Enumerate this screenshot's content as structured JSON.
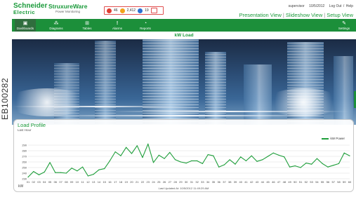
{
  "side_code": "EB100282",
  "header": {
    "brand_name": "Schneider",
    "brand_sub": "Electric",
    "product_name": "StruxureWare",
    "product_sub": "Power Monitoring",
    "alarm_counts": {
      "high": "46",
      "medium": "2,412",
      "low": "19"
    },
    "user": "supervisor",
    "date": "10/5/2012",
    "logout": "Log Out",
    "help": "Help",
    "views": [
      "Presentation View",
      "Slideshow View",
      "Setup View"
    ]
  },
  "nav": {
    "items": [
      {
        "label": "Dashboards",
        "icon": "dashboard-icon"
      },
      {
        "label": "Diagrams",
        "icon": "diagram-icon"
      },
      {
        "label": "Tables",
        "icon": "table-icon"
      },
      {
        "label": "Alarms",
        "icon": "alarm-icon"
      },
      {
        "label": "Reports",
        "icon": "report-icon"
      },
      {
        "label": "Settings",
        "icon": "settings-icon"
      }
    ]
  },
  "panel": {
    "title": "kW Load"
  },
  "card": {
    "title": "Load Profile",
    "subtitle": "Last Hour",
    "updated": "Last Updated At: 10/5/2012 11:49:29 AM",
    "unit": "kW"
  },
  "chart_data": {
    "type": "line",
    "ylabel": "kW",
    "ylim": [
      230,
      295
    ],
    "yticks": [
      230,
      240,
      250,
      260,
      270,
      280,
      290
    ],
    "series": [
      {
        "name": "kW Power",
        "color": "#1e9e3a",
        "x": [
          "01",
          "02",
          "03",
          "04",
          "05",
          "06",
          "07",
          "08",
          "09",
          "10",
          "11",
          "12",
          "13",
          "14",
          "15",
          "16",
          "17",
          "18",
          "19",
          "20",
          "21",
          "22",
          "23",
          "24",
          "25",
          "26",
          "27",
          "28",
          "29",
          "30",
          "31",
          "32",
          "33",
          "34",
          "35",
          "36",
          "37",
          "38",
          "39",
          "40",
          "41",
          "42",
          "43",
          "44",
          "45",
          "46",
          "47",
          "48",
          "49",
          "50",
          "51",
          "52",
          "53",
          "54",
          "55",
          "56",
          "57",
          "58",
          "59",
          "60"
        ],
        "values": [
          233,
          243,
          237,
          242,
          259,
          241,
          241,
          240,
          249,
          244,
          251,
          235,
          238,
          246,
          248,
          262,
          278,
          271,
          286,
          275,
          289,
          268,
          292,
          259,
          272,
          266,
          277,
          264,
          260,
          258,
          262,
          262,
          257,
          273,
          271,
          251,
          255,
          264,
          256,
          269,
          262,
          271,
          261,
          264,
          270,
          276,
          272,
          269,
          251,
          253,
          250,
          258,
          256,
          266,
          257,
          251,
          254,
          257,
          276,
          271
        ]
      }
    ]
  }
}
